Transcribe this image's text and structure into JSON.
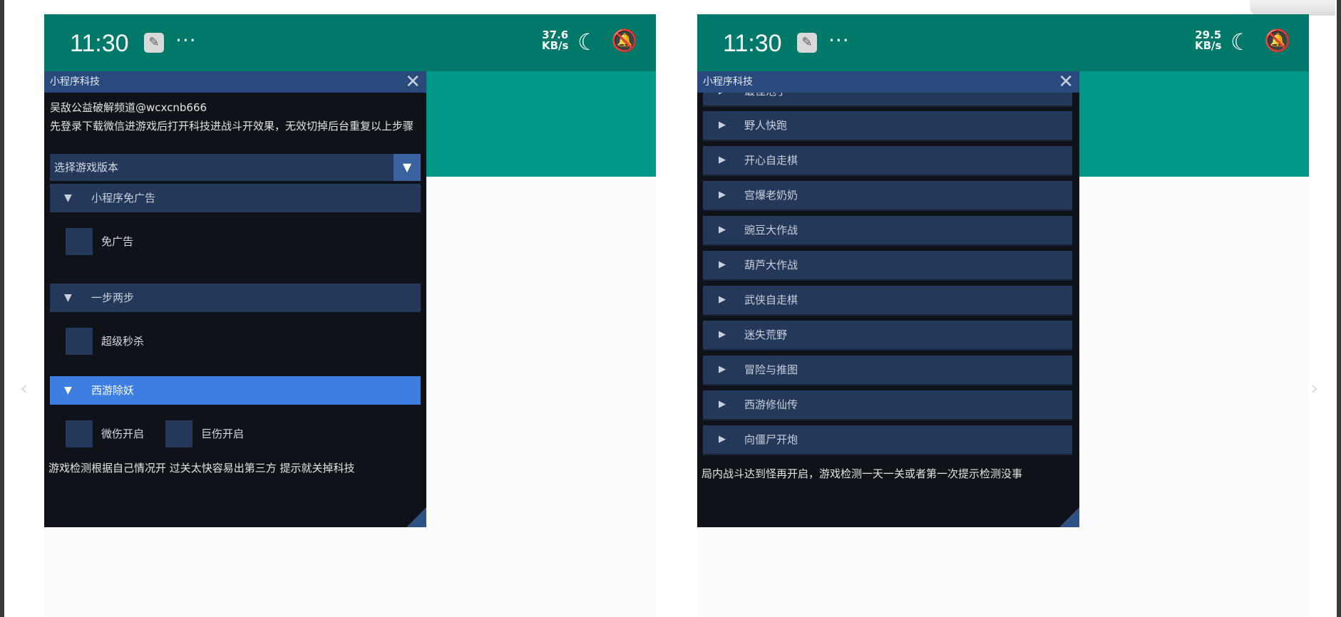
{
  "left": {
    "status": {
      "time": "11:30",
      "speed_value": "37.6",
      "speed_unit": "KB/s"
    },
    "panel": {
      "title": "小程序科技",
      "channel": "吴敌公益破解频道@wcxcnb666",
      "instruction": "先登录下载微信进游戏后打开科技进战斗开效果，无效切掉后台重复以上步骤",
      "select_label": "选择游戏版本",
      "sections": [
        {
          "label": "小程序免广告",
          "checkbox": "免广告"
        },
        {
          "label": "一步两步",
          "checkbox": "超级秒杀"
        },
        {
          "label": "西游除妖",
          "checkboxes": [
            "微伤开启",
            "巨伤开启"
          ]
        }
      ],
      "footer": "游戏检测根据自己情况开  过关太快容易出第三方 提示就关掉科技"
    }
  },
  "right": {
    "status": {
      "time": "11:30",
      "speed_value": "29.5",
      "speed_unit": "KB/s"
    },
    "panel": {
      "title": "小程序科技",
      "partial_item": "最佳泡手",
      "items": [
        "野人快跑",
        "开心自走棋",
        "宫爆老奶奶",
        "豌豆大作战",
        "葫芦大作战",
        "武侠自走棋",
        "迷失荒野",
        "冒险与推图",
        "西游修仙传",
        "向僵尸开炮"
      ],
      "footer": "局内战斗达到怪再开启，游戏检测一天一关或者第一次提示检测没事"
    }
  },
  "icons": {
    "wrench": "wrench-icon",
    "moon": "moon-icon",
    "bell_off": "bell-off-icon",
    "close": "close-icon"
  },
  "colors": {
    "status_bar": "#00796b",
    "teal": "#009688",
    "panel_bg": "#0f1218",
    "header": "#24395a",
    "active": "#3d7fe0"
  }
}
